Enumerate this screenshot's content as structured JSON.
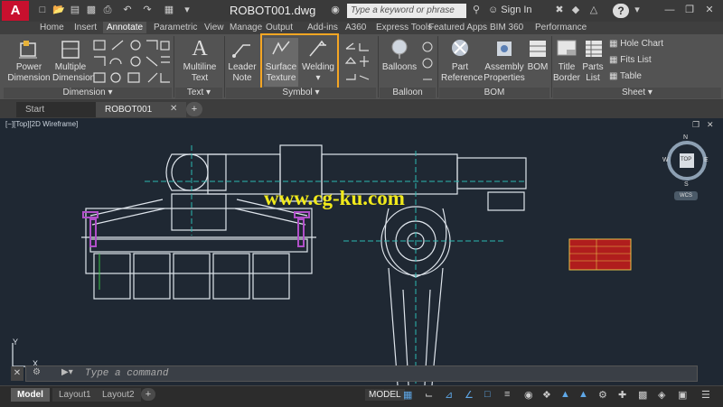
{
  "app": {
    "logo_letter": "A",
    "document_title": "ROBOT001.dwg",
    "search_placeholder": "Type a keyword or phrase",
    "sign_in": "Sign In",
    "help": "?"
  },
  "ribbon_tabs": [
    "Home",
    "Insert",
    "Annotate",
    "Parametric",
    "View",
    "Manage",
    "Output",
    "Add-ins",
    "A360",
    "Express Tools",
    "Featured Apps",
    "BIM 360",
    "Performance"
  ],
  "active_tab": "Annotate",
  "ribbon": {
    "power_dimension": "Power\nDimension",
    "multiple_dimension": "Multiple\nDimension",
    "multiline_text": "Multiline\nText",
    "leader_note": "Leader\nNote",
    "surface_texture": "Surface\nTexture",
    "welding": "Welding",
    "balloons": "Balloons",
    "part_reference": "Part\nReference",
    "assembly_properties": "Assembly\nProperties",
    "bom": "BOM",
    "title_border": "Title\nBorder",
    "parts_list": "Parts\nList",
    "hole_chart": "Hole Chart",
    "fits_list": "Fits List",
    "table": "Table",
    "panels": {
      "dimension": "Dimension",
      "text": "Text",
      "symbol": "Symbol",
      "balloon": "Balloon",
      "bom": "BOM",
      "sheet": "Sheet"
    }
  },
  "doc_tabs": [
    "Start",
    "ROBOT001"
  ],
  "viewport_label": "[−][Top][2D Wireframe]",
  "viewcube": {
    "n": "N",
    "s": "S",
    "e": "E",
    "w": "W",
    "top": "TOP",
    "wcs": "WCS"
  },
  "watermark": "www.cg-ku.com",
  "command_placeholder": "Type a command",
  "ucs": {
    "x": "X",
    "y": "Y"
  },
  "layout_tabs": [
    "Model",
    "Layout1",
    "Layout2"
  ],
  "status": {
    "model": "MODEL"
  },
  "colors": {
    "accent": "#f5a623",
    "canvas": "#1f2833",
    "ribbon": "#535353",
    "autocad_red": "#c8102e",
    "watermark": "#f1ea1b"
  }
}
